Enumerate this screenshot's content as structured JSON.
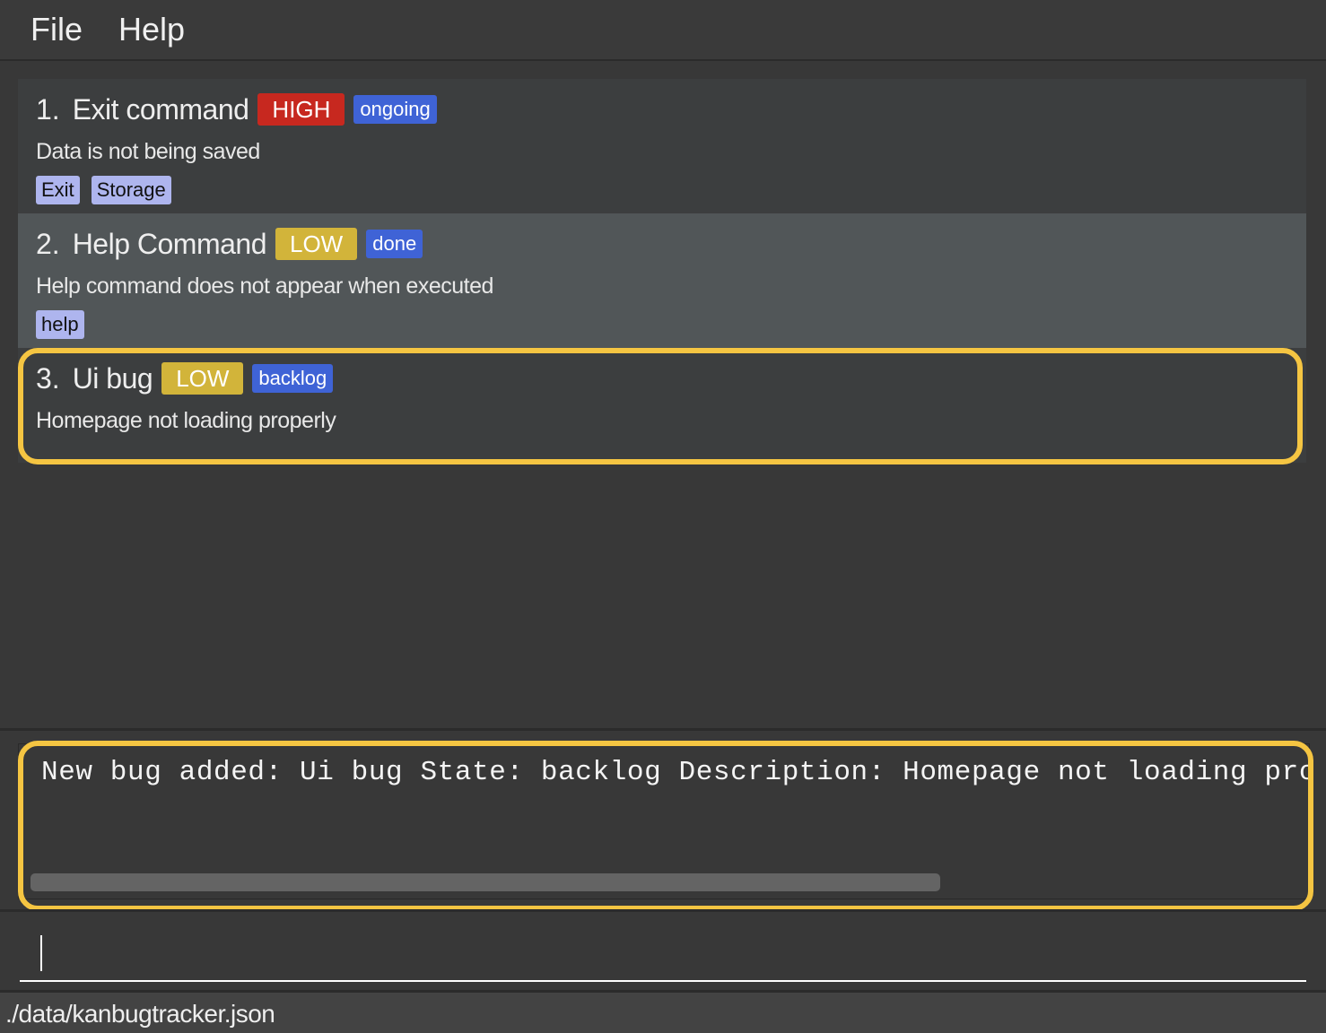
{
  "menu": {
    "items": [
      {
        "label": "File"
      },
      {
        "label": "Help"
      }
    ]
  },
  "colors": {
    "priority_high": "#c7281f",
    "priority_low": "#d2b43a",
    "state": "#3f63d6",
    "tag": "#aeb5ee",
    "selection_highlight": "#f5c542"
  },
  "bugs": [
    {
      "index": "1.",
      "title": "Exit command",
      "priority": "HIGH",
      "state": "ongoing",
      "description": "Data is not being saved",
      "tags": [
        "Exit",
        "Storage"
      ]
    },
    {
      "index": "2.",
      "title": "Help Command",
      "priority": "LOW",
      "state": "done",
      "description": "Help command does not appear when executed",
      "tags": [
        "help"
      ]
    },
    {
      "index": "3.",
      "title": "Ui bug",
      "priority": "LOW",
      "state": "backlog",
      "description": "Homepage not loading properly",
      "tags": []
    }
  ],
  "result": {
    "text": "New bug added: Ui bug State: backlog Description: Homepage not loading properly"
  },
  "command": {
    "value": "",
    "placeholder": ""
  },
  "status": {
    "file_path": "./data/kanbugtracker.json"
  }
}
